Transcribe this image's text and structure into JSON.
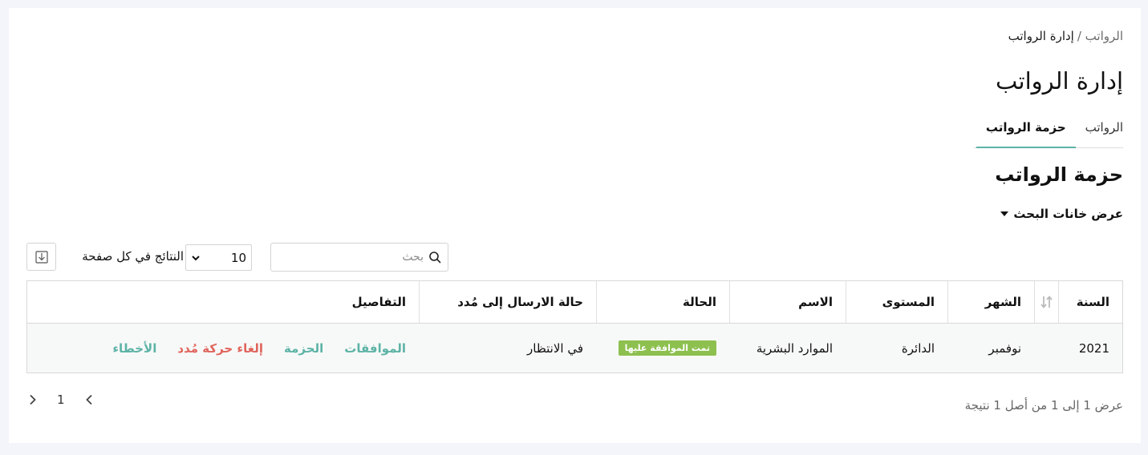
{
  "breadcrumb": {
    "parent": "الرواتب /",
    "current": "إدارة الرواتب"
  },
  "page_title": "إدارة الرواتب",
  "tabs": [
    {
      "label": "الرواتب",
      "active": false
    },
    {
      "label": "حزمة الرواتب",
      "active": true
    }
  ],
  "section_title": "حزمة الرواتب",
  "search_toggle": {
    "label": "عرض خانات البحث",
    "icon": "caret-down-icon"
  },
  "search": {
    "placeholder": "بحث",
    "value": "",
    "icon": "search-icon"
  },
  "per_page": {
    "label": "النتائج في كل صفحة",
    "value": "10"
  },
  "export": {
    "icon": "download-icon"
  },
  "table": {
    "columns": [
      "السنة",
      "الشهر",
      "المستوى",
      "الاسم",
      "الحالة",
      "حالة الارسال إلى مُدد",
      "التفاصيل"
    ],
    "rows": [
      {
        "year": "2021",
        "month": "نوفمبر",
        "level": "الدائرة",
        "name": "الموارد البشرية",
        "status": "تمت الموافقة عليها",
        "send_status": "في الانتظار",
        "actions": [
          "الموافقات",
          "الحزمة",
          "إلغاء حركة مُدد",
          "الأخطاء"
        ]
      }
    ]
  },
  "summary": "عرض 1 إلى 1 من أصل 1 نتيجة",
  "pagination": {
    "page": "1"
  },
  "colors": {
    "accent": "#5db3a6",
    "danger": "#e0645c",
    "badge": "#8dc04f"
  }
}
